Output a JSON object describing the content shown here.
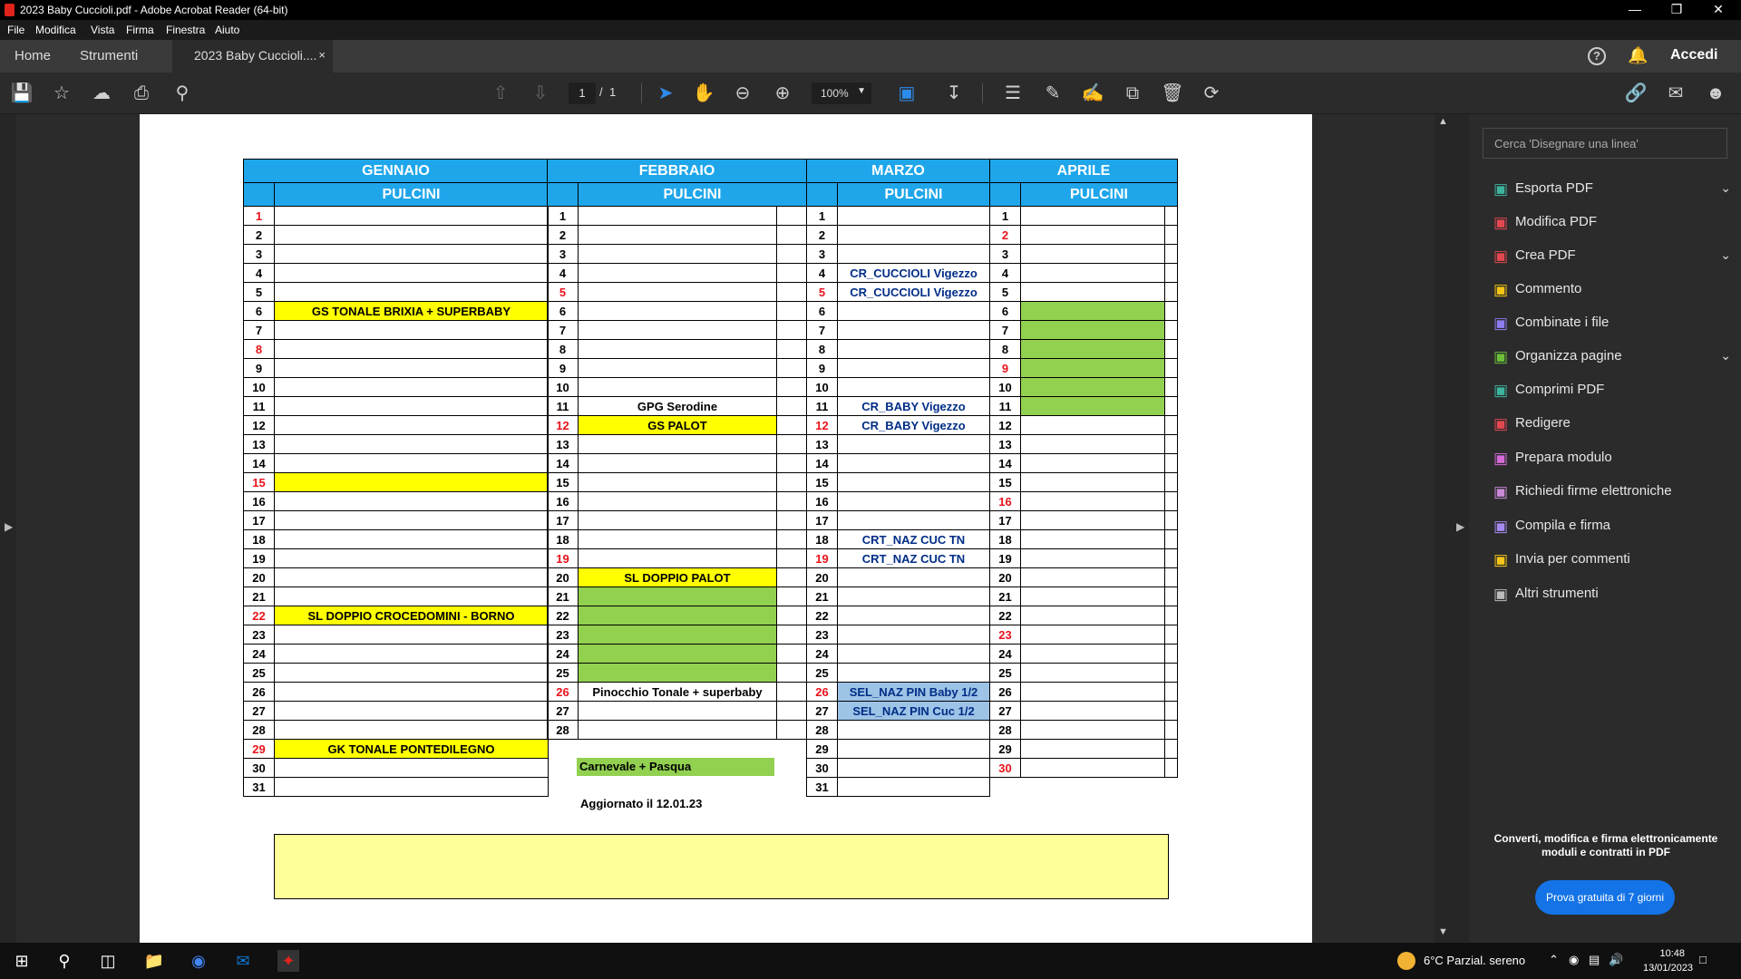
{
  "window": {
    "title": "2023 Baby Cuccioli.pdf - Adobe Acrobat Reader (64-bit)",
    "minimize": "—",
    "maximize": "❐",
    "close": "✕"
  },
  "menu": [
    "File",
    "Modifica",
    "Vista",
    "Firma",
    "Finestra",
    "Aiuto"
  ],
  "tabs": {
    "home": "Home",
    "tools": "Strumenti",
    "document": "2023 Baby Cuccioli....",
    "close": "×",
    "signin": "Accedi",
    "help": "?"
  },
  "toolbar": {
    "page_current": "1",
    "page_sep": "/",
    "page_total": "1",
    "zoom": "100%",
    "icons": [
      "save-icon",
      "star-icon",
      "upload-icon",
      "print-icon",
      "search-zoom-icon",
      "page-up-icon",
      "page-down-icon",
      "select-cursor-icon",
      "hand-icon",
      "zoom-out-icon",
      "zoom-in-icon",
      "fit-page-icon",
      "scroll-mode-icon",
      "comment-icon",
      "pen-icon",
      "sign-icon",
      "share-icon",
      "delete-icon",
      "rotate-icon",
      "link-icon",
      "mail-icon",
      "account-icon"
    ]
  },
  "document": {
    "months": [
      "GENNAIO",
      "FEBBRAIO",
      "MARZO",
      "APRILE"
    ],
    "subheaders": [
      "PULCINI",
      "PULCINI",
      "PULCINI",
      "PULCINI"
    ],
    "gennaio": {
      "days": [
        "1",
        "2",
        "3",
        "4",
        "5",
        "6",
        "7",
        "8",
        "9",
        "10",
        "11",
        "12",
        "13",
        "14",
        "15",
        "16",
        "17",
        "18",
        "19",
        "20",
        "21",
        "22",
        "23",
        "24",
        "25",
        "26",
        "27",
        "28",
        "29",
        "30",
        "31"
      ],
      "red_days": [
        "1",
        "8",
        "15",
        "22",
        "29"
      ],
      "events": {
        "6": "GS TONALE BRIXIA + SUPERBABY",
        "22": "SL DOPPIO CROCEDOMINI - BORNO",
        "29": "GK TONALE PONTEDILEGNO"
      },
      "yellow_days": [
        "6",
        "15",
        "22",
        "29"
      ]
    },
    "febbraio": {
      "days": [
        "1",
        "2",
        "3",
        "4",
        "5",
        "6",
        "7",
        "8",
        "9",
        "10",
        "11",
        "12",
        "13",
        "14",
        "15",
        "16",
        "17",
        "18",
        "19",
        "20",
        "21",
        "22",
        "23",
        "24",
        "25",
        "26",
        "27",
        "28"
      ],
      "red_days": [
        "5",
        "12",
        "19",
        "26"
      ],
      "events": {
        "11": "GPG Serodine",
        "12": "GS PALOT",
        "20": "SL DOPPIO PALOT",
        "26": "Pinocchio Tonale + superbaby"
      },
      "yellow_days": [
        "12",
        "20"
      ],
      "green_days": [
        "21",
        "22",
        "23",
        "24",
        "25"
      ]
    },
    "marzo": {
      "days": [
        "1",
        "2",
        "3",
        "4",
        "5",
        "6",
        "7",
        "8",
        "9",
        "10",
        "11",
        "12",
        "13",
        "14",
        "15",
        "16",
        "17",
        "18",
        "19",
        "20",
        "21",
        "22",
        "23",
        "24",
        "25",
        "26",
        "27",
        "28",
        "29",
        "30",
        "31"
      ],
      "red_days": [
        "5",
        "12",
        "19",
        "26"
      ],
      "events": {
        "4": "CR_CUCCIOLI Vigezzo",
        "5": "CR_CUCCIOLI Vigezzo",
        "11": "CR_BABY Vigezzo",
        "12": "CR_BABY Vigezzo",
        "18": "CRT_NAZ CUC TN",
        "19": "CRT_NAZ CUC TN",
        "26": "SEL_NAZ PIN Baby 1/2",
        "27": "SEL_NAZ PIN Cuc 1/2"
      },
      "blue_days": [
        "26",
        "27"
      ]
    },
    "aprile": {
      "days": [
        "1",
        "2",
        "3",
        "4",
        "5",
        "6",
        "7",
        "8",
        "9",
        "10",
        "11",
        "12",
        "13",
        "14",
        "15",
        "16",
        "17",
        "18",
        "19",
        "20",
        "21",
        "22",
        "23",
        "24",
        "25",
        "26",
        "27",
        "28",
        "29",
        "30"
      ],
      "red_days": [
        "2",
        "9",
        "16",
        "23",
        "30"
      ],
      "green_days": [
        "6",
        "7",
        "8",
        "9",
        "10",
        "11"
      ]
    },
    "legend_green": "Carnevale + Pasqua",
    "updated": "Aggiornato il 12.01.23"
  },
  "panel": {
    "search_placeholder": "Cerca 'Disegnare una linea'",
    "items": [
      {
        "label": "Esporta PDF",
        "icon": "export-pdf-icon",
        "color": "#3db39e",
        "chevron": true
      },
      {
        "label": "Modifica PDF",
        "icon": "edit-pdf-icon",
        "color": "#e34850",
        "chevron": false
      },
      {
        "label": "Crea PDF",
        "icon": "create-pdf-icon",
        "color": "#e34850",
        "chevron": true
      },
      {
        "label": "Commento",
        "icon": "comment-icon",
        "color": "#f5c518",
        "chevron": false
      },
      {
        "label": "Combinate i file",
        "icon": "combine-files-icon",
        "color": "#8c7ef0",
        "chevron": false
      },
      {
        "label": "Organizza pagine",
        "icon": "organize-pages-icon",
        "color": "#6bbf3a",
        "chevron": true
      },
      {
        "label": "Comprimi PDF",
        "icon": "compress-pdf-icon",
        "color": "#3db39e",
        "chevron": false
      },
      {
        "label": "Redigere",
        "icon": "redact-icon",
        "color": "#e34850",
        "chevron": false
      },
      {
        "label": "Prepara modulo",
        "icon": "prepare-form-icon",
        "color": "#d36ad8",
        "chevron": false
      },
      {
        "label": "Richiedi firme elettroniche",
        "icon": "request-signatures-icon",
        "color": "#c98ad8",
        "chevron": false
      },
      {
        "label": "Compila e firma",
        "icon": "fill-sign-icon",
        "color": "#a58af0",
        "chevron": false
      },
      {
        "label": "Invia per commenti",
        "icon": "send-comments-icon",
        "color": "#f5c518",
        "chevron": false
      },
      {
        "label": "Altri strumenti",
        "icon": "more-tools-icon",
        "color": "#bbbbbb",
        "chevron": false
      }
    ],
    "promo": "Converti, modifica e firma elettronicamente moduli e contratti in PDF",
    "trial_button": "Prova gratuita di 7 giorni"
  },
  "taskbar": {
    "weather": "6°C  Parzial. sereno",
    "time": "10:48",
    "date": "13/01/2023"
  }
}
